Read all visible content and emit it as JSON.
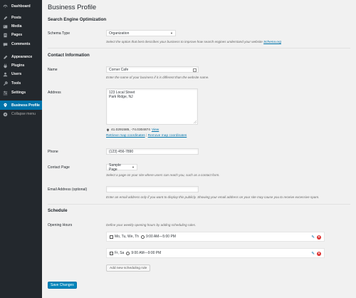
{
  "sidebar": {
    "items": [
      {
        "label": "Dashboard",
        "icon": "dashboard-icon"
      },
      {
        "label": "Posts",
        "icon": "posts-icon"
      },
      {
        "label": "Media",
        "icon": "media-icon"
      },
      {
        "label": "Pages",
        "icon": "pages-icon"
      },
      {
        "label": "Comments",
        "icon": "comments-icon"
      },
      {
        "label": "Appearance",
        "icon": "appearance-icon"
      },
      {
        "label": "Plugins",
        "icon": "plugins-icon"
      },
      {
        "label": "Users",
        "icon": "users-icon"
      },
      {
        "label": "Tools",
        "icon": "tools-icon"
      },
      {
        "label": "Settings",
        "icon": "settings-icon"
      },
      {
        "label": "Business Profile",
        "icon": "location-icon",
        "active": true
      },
      {
        "label": "Collapse menu",
        "icon": "collapse-icon"
      }
    ]
  },
  "page": {
    "title": "Business Profile",
    "seo_section": "Search Engine Optimization",
    "schema_type": {
      "label": "Schema Type",
      "value": "Organization",
      "desc_prefix": "Select the option that best describes your business to improve how search engines understand your website",
      "desc_link": "Schema.org"
    },
    "contact_section": "Contact Information",
    "name": {
      "label": "Name",
      "value": "Corner Cafe",
      "desc": "Enter the name of your business if it is different than the website name."
    },
    "address": {
      "label": "Address",
      "line1": "123 Local Street",
      "line2": "Park Ridge, NJ",
      "coords": "41.0291585, -74.0304874",
      "view_link": "View",
      "retrieve_link": "Retrieve map coordinates",
      "separator": "|",
      "remove_link": "Remove map coordinates"
    },
    "phone": {
      "label": "Phone",
      "value": "(123) 456-7890"
    },
    "contact_page": {
      "label": "Contact Page",
      "value": "Sample Page",
      "desc": "Select a page on your site where users can reach you, such as a contact form."
    },
    "email": {
      "label": "Email Address (optional)",
      "value": "",
      "desc": "Enter an email address only if you want to display this publicly. Showing your email address on your site may cause you to receive excessive spam."
    },
    "schedule_section": "Schedule",
    "opening_hours": {
      "label": "Opening Hours",
      "desc": "Define your weekly opening hours by adding scheduling rules.",
      "rules": [
        {
          "days": "Mo, Tu, We, Th",
          "hours": "9:00 AM—5:00 PM"
        },
        {
          "days": "Fr, Sa",
          "hours": "9:00 AM—9:00 PM"
        }
      ],
      "add_rule": "Add new scheduling rule"
    },
    "save_button": "Save Changes"
  },
  "colors": {
    "sidebar_bg": "#23282d",
    "active_bg": "#0073aa",
    "primary_button": "#0085ba",
    "link": "#0073aa",
    "delete": "#dc3232"
  }
}
